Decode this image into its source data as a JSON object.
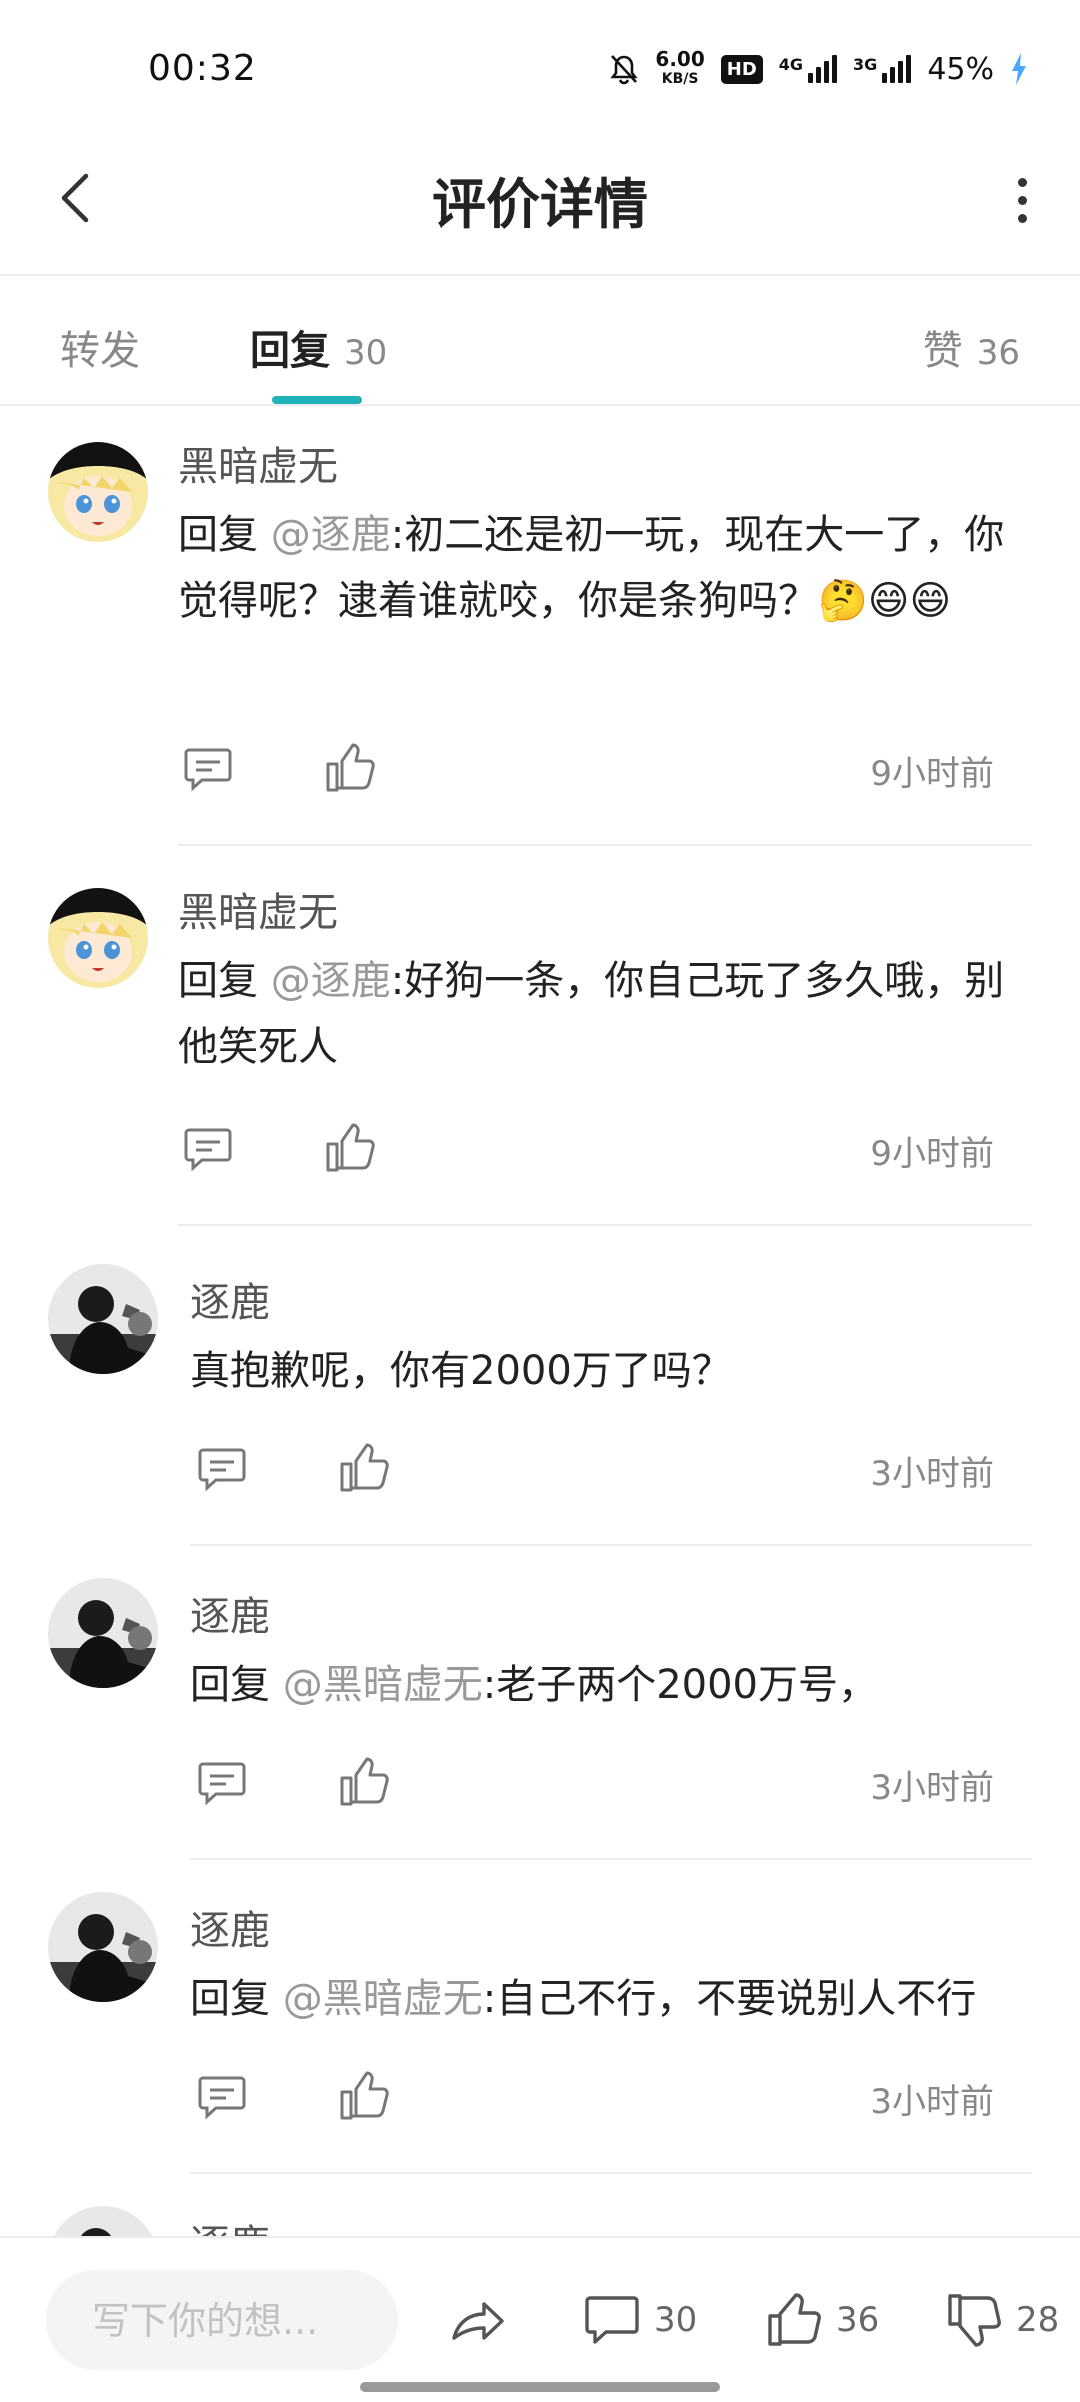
{
  "status_bar": {
    "time": "00:32",
    "speed_value": "6.00",
    "speed_unit": "KB/S",
    "hd_label": "HD",
    "network1": "4G",
    "network2": "3G",
    "battery": "45%",
    "icons": [
      "bell-mute-icon",
      "signal-icon",
      "battery-charging-icon"
    ]
  },
  "header": {
    "title": "评价详情"
  },
  "tabs": [
    {
      "label": "转发",
      "count": ""
    },
    {
      "label": "回复",
      "count": "30",
      "active": true
    },
    {
      "label": "赞",
      "count": "36"
    }
  ],
  "comments": [
    {
      "user": "黑暗虚无",
      "prefix": " 回复 ",
      "mention": "@逐鹿",
      "text": ":初二还是初一玩，现在大一了，你觉得呢？逮着谁就咬，你是条狗吗？🤔😄😄",
      "time": "9小时前",
      "avatar_style": "anime"
    },
    {
      "user": "黑暗虚无",
      "prefix": " 回复 ",
      "mention": "@逐鹿",
      "text": ":好狗一条，你自己玩了多久哦，别他笑死人",
      "time": "9小时前",
      "avatar_style": "anime"
    },
    {
      "user": "逐鹿",
      "prefix": "",
      "mention": "",
      "text": "真抱歉呢，你有2000万了吗？",
      "time": "3小时前",
      "avatar_style": "rider"
    },
    {
      "user": "逐鹿",
      "prefix": " 回复 ",
      "mention": "@黑暗虚无",
      "text": ":老子两个2000万号，",
      "time": "3小时前",
      "avatar_style": "rider"
    },
    {
      "user": "逐鹿",
      "prefix": " 回复 ",
      "mention": "@黑暗虚无",
      "text": ":自己不行，不要说别人不行",
      "time": "3小时前",
      "avatar_style": "rider"
    },
    {
      "user": "逐鹿",
      "prefix": "",
      "mention": "",
      "text": "",
      "time": "",
      "avatar_style": "rider"
    }
  ],
  "bottom_bar": {
    "input_placeholder": "写下你的想...",
    "comment_count": "30",
    "like_count": "36",
    "dislike_count": "28"
  },
  "colors": {
    "accent": "#1fb3b8",
    "text_primary": "#222222",
    "text_secondary": "#888888",
    "mention": "#999999",
    "divider": "#ececec"
  }
}
